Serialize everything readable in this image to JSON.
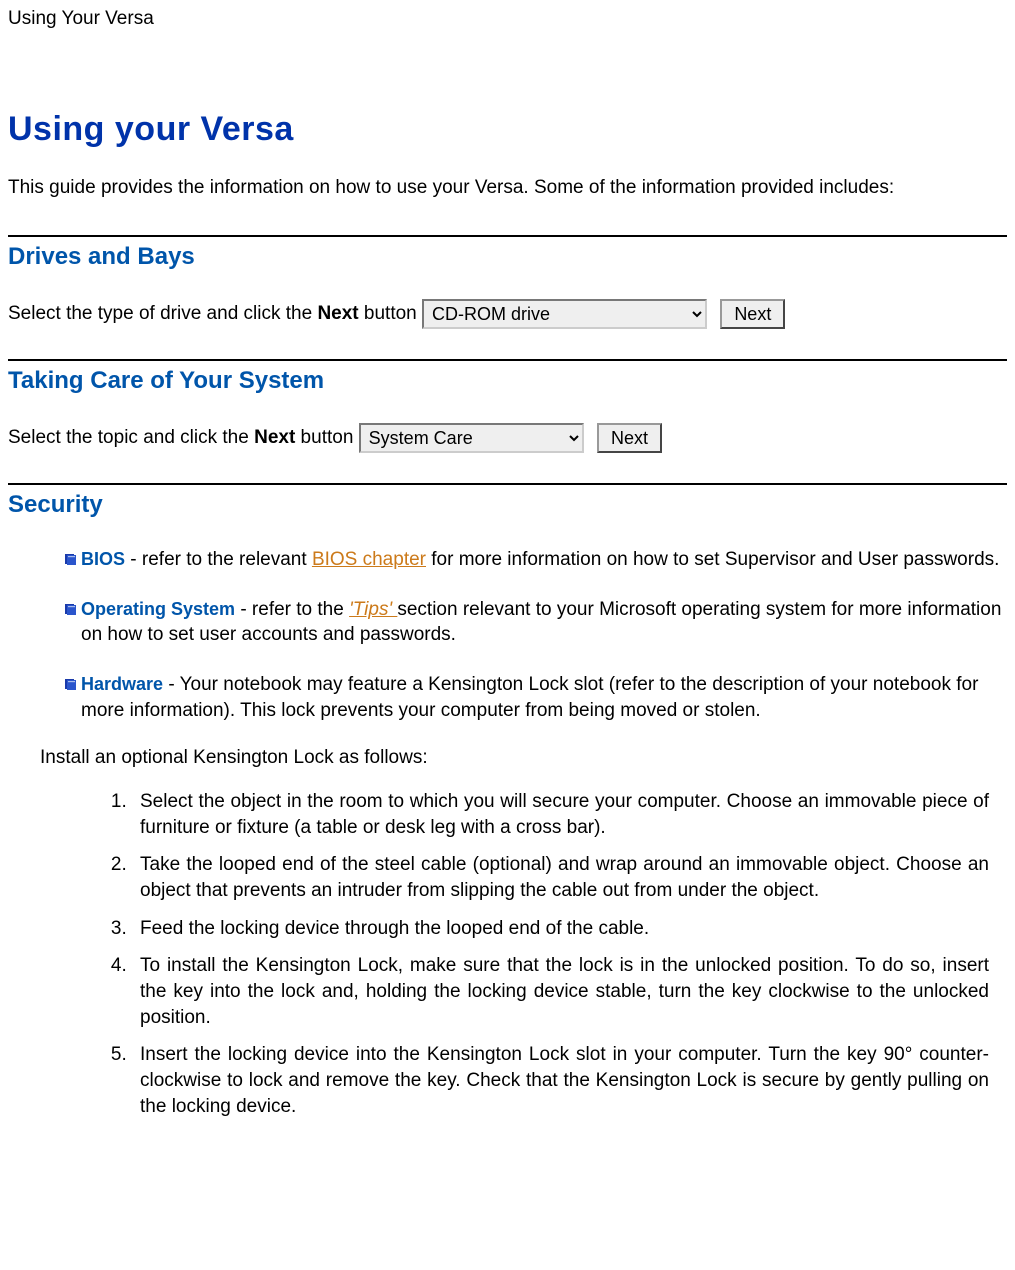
{
  "page_header": "Using Your Versa",
  "title": "Using your Versa",
  "intro": "This guide provides the information on how to use your Versa. Some of the information provided includes:",
  "drives": {
    "heading": "Drives and Bays",
    "prompt_pre": "Select the type of drive and click the ",
    "prompt_bold": "Next",
    "prompt_post": " button ",
    "select_value": "CD-ROM drive",
    "button": "Next"
  },
  "care": {
    "heading": "Taking Care of Your System",
    "prompt_pre": "Select the topic and click the ",
    "prompt_bold": "Next",
    "prompt_post": " button ",
    "select_value": "System Care",
    "button": "Next"
  },
  "security": {
    "heading": "Security",
    "bios": {
      "title": "BIOS",
      "pre": " - refer to the relevant ",
      "link": "BIOS chapter",
      "post": " for more information on how to set Supervisor and User passwords."
    },
    "os": {
      "title": "Operating System",
      "pre": " - refer to the ",
      "link": "'Tips' ",
      "post": "section relevant to your Microsoft operating system for more information on how to set user accounts and passwords."
    },
    "hardware": {
      "title": "Hardware",
      "text": " - Your notebook may feature a Kensington Lock slot (refer to the description of your notebook for more information). This lock prevents your computer from being moved or stolen."
    },
    "install_intro": "Install an optional Kensington Lock as follows:",
    "steps": [
      "Select the object in the room to which you will secure your computer. Choose an immovable piece of furniture or fixture (a table or desk leg with a cross bar).",
      "Take the looped end of the steel cable (optional) and wrap around an immovable object. Choose an object that prevents an intruder from slipping the cable out from under the object.",
      "Feed the locking device through the looped end of the cable.",
      "To install the Kensington Lock, make sure that the lock is in the unlocked position. To do so, insert the key into the lock and, holding the locking device stable, turn the key clockwise to the unlocked position.",
      "Insert the locking device into the Kensington Lock slot in your computer. Turn the key 90° counter-clockwise to lock and remove the key. Check that the Kensington Lock is secure by gently pulling on the locking device."
    ]
  }
}
